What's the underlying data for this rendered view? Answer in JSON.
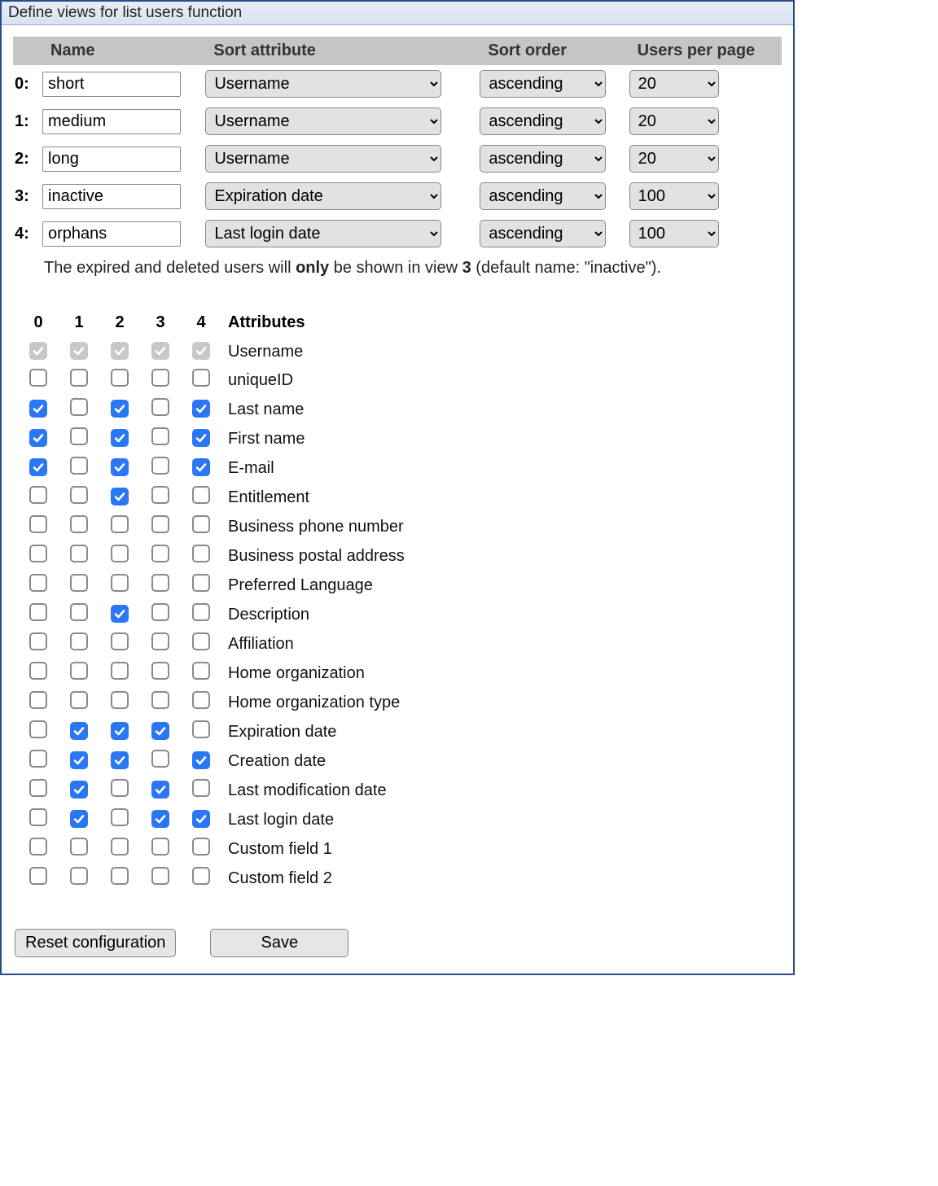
{
  "window": {
    "title": "Define views for list users function"
  },
  "views_table": {
    "headers": {
      "name": "Name",
      "sort_attr": "Sort attribute",
      "sort_order": "Sort order",
      "per_page": "Users per page"
    },
    "rows": [
      {
        "idx": "0:",
        "name": "short",
        "sort_attr": "Username",
        "sort_order": "ascending",
        "per_page": "20"
      },
      {
        "idx": "1:",
        "name": "medium",
        "sort_attr": "Username",
        "sort_order": "ascending",
        "per_page": "20"
      },
      {
        "idx": "2:",
        "name": "long",
        "sort_attr": "Username",
        "sort_order": "ascending",
        "per_page": "20"
      },
      {
        "idx": "3:",
        "name": "inactive",
        "sort_attr": "Expiration date",
        "sort_order": "ascending",
        "per_page": "100"
      },
      {
        "idx": "4:",
        "name": "orphans",
        "sort_attr": "Last login date",
        "sort_order": "ascending",
        "per_page": "100"
      }
    ]
  },
  "note": {
    "pre": "The expired and deleted users will ",
    "only": "only",
    "mid": " be shown in view ",
    "viewnum": "3",
    "post": " (default name: \"inactive\")."
  },
  "attr_table": {
    "col_headers": [
      "0",
      "1",
      "2",
      "3",
      "4"
    ],
    "attr_header": "Attributes",
    "rows": [
      {
        "label": "Username",
        "cells": [
          "disabled",
          "disabled",
          "disabled",
          "disabled",
          "disabled"
        ]
      },
      {
        "label": "uniqueID",
        "cells": [
          "off",
          "off",
          "off",
          "off",
          "off"
        ]
      },
      {
        "label": "Last name",
        "cells": [
          "on",
          "off",
          "on",
          "off",
          "on"
        ]
      },
      {
        "label": "First name",
        "cells": [
          "on",
          "off",
          "on",
          "off",
          "on"
        ]
      },
      {
        "label": "E-mail",
        "cells": [
          "on",
          "off",
          "on",
          "off",
          "on"
        ]
      },
      {
        "label": "Entitlement",
        "cells": [
          "off",
          "off",
          "on",
          "off",
          "off"
        ]
      },
      {
        "label": "Business phone number",
        "cells": [
          "off",
          "off",
          "off",
          "off",
          "off"
        ]
      },
      {
        "label": "Business postal address",
        "cells": [
          "off",
          "off",
          "off",
          "off",
          "off"
        ]
      },
      {
        "label": "Preferred Language",
        "cells": [
          "off",
          "off",
          "off",
          "off",
          "off"
        ]
      },
      {
        "label": "Description",
        "cells": [
          "off",
          "off",
          "on",
          "off",
          "off"
        ]
      },
      {
        "label": "Affiliation",
        "cells": [
          "off",
          "off",
          "off",
          "off",
          "off"
        ]
      },
      {
        "label": "Home organization",
        "cells": [
          "off",
          "off",
          "off",
          "off",
          "off"
        ]
      },
      {
        "label": "Home organization type",
        "cells": [
          "off",
          "off",
          "off",
          "off",
          "off"
        ]
      },
      {
        "label": "Expiration date",
        "cells": [
          "off",
          "on",
          "on",
          "on",
          "off"
        ]
      },
      {
        "label": "Creation date",
        "cells": [
          "off",
          "on",
          "on",
          "off",
          "on"
        ]
      },
      {
        "label": "Last modification date",
        "cells": [
          "off",
          "on",
          "off",
          "on",
          "off"
        ]
      },
      {
        "label": "Last login date",
        "cells": [
          "off",
          "on",
          "off",
          "on",
          "on"
        ]
      },
      {
        "label": "Custom field 1",
        "cells": [
          "off",
          "off",
          "off",
          "off",
          "off"
        ]
      },
      {
        "label": "Custom field 2",
        "cells": [
          "off",
          "off",
          "off",
          "off",
          "off"
        ]
      }
    ]
  },
  "buttons": {
    "reset": "Reset configuration",
    "save": "Save"
  }
}
